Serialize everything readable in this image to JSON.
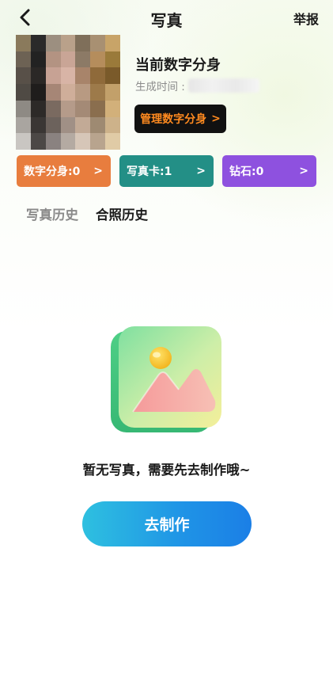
{
  "header": {
    "title": "写真",
    "report_label": "举报"
  },
  "profile": {
    "name": "当前数字分身",
    "generated_label": "生成时间 :",
    "manage_label": "管理数字分身",
    "manage_arrow": ">"
  },
  "stats": [
    {
      "label": "数字分身:0",
      "arrow": ">",
      "color": "#e87d3e"
    },
    {
      "label": "写真卡:1",
      "arrow": ">",
      "color": "#238f86"
    },
    {
      "label": "钻石:0",
      "arrow": ">",
      "color": "#8e51df"
    }
  ],
  "tabs": [
    {
      "label": "写真历史",
      "active": false
    },
    {
      "label": "合照历史",
      "active": true
    }
  ],
  "empty_state": {
    "message": "暂无写真，需要先去制作哦~",
    "icon": "image-placeholder-icon"
  },
  "actions": {
    "make_label": "去制作"
  }
}
